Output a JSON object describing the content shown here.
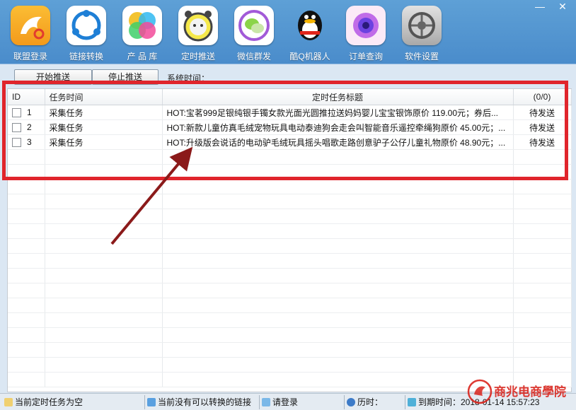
{
  "window": {
    "minimize_icon": "minimize-icon",
    "close_icon": "close-icon",
    "close_glyph": "✕",
    "minimize_glyph": "—"
  },
  "toolbar": [
    {
      "id": "union-login",
      "label": "联盟登录",
      "icon": "kangaroo-logo-icon"
    },
    {
      "id": "link-convert",
      "label": "链接转换",
      "icon": "share-nodes-icon"
    },
    {
      "id": "product-lib",
      "label": "产 品 库",
      "icon": "colorful-circles-icon"
    },
    {
      "id": "scheduled-push",
      "label": "定时推送",
      "icon": "alarm-clock-icon"
    },
    {
      "id": "wechat-group",
      "label": "微信群发",
      "icon": "wechat-icon"
    },
    {
      "id": "qq-robot",
      "label": "酷Q机器人",
      "icon": "qq-penguin-icon"
    },
    {
      "id": "order-query",
      "label": "订单查询",
      "icon": "purple-orb-icon"
    },
    {
      "id": "settings",
      "label": "软件设置",
      "icon": "gear-settings-icon"
    }
  ],
  "actions": {
    "start_label": "开始推送",
    "stop_label": "停止推送",
    "system_time_label": "系统时间："
  },
  "table": {
    "headers": {
      "id": "ID",
      "time": "任务时间",
      "title": "定时任务标题",
      "count": "(0/0)"
    },
    "rows": [
      {
        "id": "1",
        "time": "采集任务",
        "title": "HOT:宝茗999足银纯银手镯女款光面光圆推拉送妈妈婴儿宝宝银饰原价 119.00元；券后...",
        "status": "待发送"
      },
      {
        "id": "2",
        "time": "采集任务",
        "title": "HOT:新款儿童仿真毛绒宠物玩具电动泰迪狗会走会叫智能音乐遥控牵绳狗原价 45.00元；...",
        "status": "待发送"
      },
      {
        "id": "3",
        "time": "采集任务",
        "title": "HOT:升级版会说话的电动驴毛绒玩具摇头唱歌走路创意驴子公仔儿童礼物原价 48.90元；...",
        "status": "待发送"
      }
    ]
  },
  "status_bar": {
    "task": "当前定时任务为空",
    "link": "当前没有可以转换的链接",
    "login": "请登录",
    "history": "历时：",
    "expire": "到期时间：2018-01-14 15:57:23"
  },
  "watermark": {
    "text": "商兆电商學院"
  },
  "colors": {
    "annotation_red": "#e0252c",
    "arrow_dark_red": "#8b1a1a",
    "title_bar_blue": "#4a8ccb"
  }
}
